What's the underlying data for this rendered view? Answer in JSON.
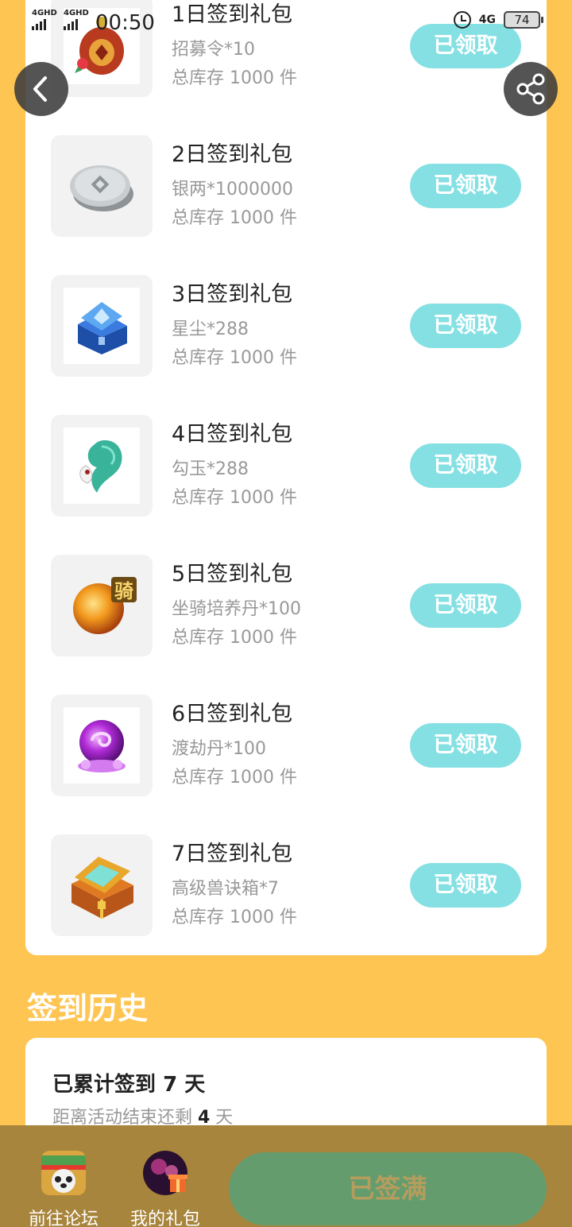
{
  "status_bar": {
    "sim1": "4GHD",
    "sim2": "4GHD",
    "time": "00:50",
    "network": "4G",
    "battery": "74"
  },
  "colors": {
    "page_bg": "#FFC552",
    "claim_button": "#85E0E3",
    "primary_button": "#659C6E",
    "bottom_bar": "#A8853C"
  },
  "nav": {
    "back_icon": "chevron-left-icon",
    "share_icon": "share-icon"
  },
  "gifts": [
    {
      "title": "1日签到礼包",
      "item": "招募令*10",
      "stock": "总库存 1000 件",
      "button": "已领取",
      "icon": "token-bag-icon"
    },
    {
      "title": "2日签到礼包",
      "item": "银两*1000000",
      "stock": "总库存 1000 件",
      "button": "已领取",
      "icon": "silver-coin-icon"
    },
    {
      "title": "3日签到礼包",
      "item": "星尘*288",
      "stock": "总库存 1000 件",
      "button": "已领取",
      "icon": "blue-chest-icon"
    },
    {
      "title": "4日签到礼包",
      "item": "勾玉*288",
      "stock": "总库存 1000 件",
      "button": "已领取",
      "icon": "magatama-icon"
    },
    {
      "title": "5日签到礼包",
      "item": "坐骑培养丹*100",
      "stock": "总库存 1000 件",
      "button": "已领取",
      "icon": "mount-pill-icon",
      "badge": "骑"
    },
    {
      "title": "6日签到礼包",
      "item": "渡劫丹*100",
      "stock": "总库存 1000 件",
      "button": "已领取",
      "icon": "purple-orb-icon"
    },
    {
      "title": "7日签到礼包",
      "item": "高级兽诀箱*7",
      "stock": "总库存 1000 件",
      "button": "已领取",
      "icon": "gold-chest-icon"
    }
  ],
  "history": {
    "title": "签到历史",
    "total_prefix": "已累计签到 ",
    "total_days": "7",
    "total_suffix": " 天",
    "remain_prefix": "距离活动结束还剩 ",
    "remain_days": "4",
    "remain_suffix": " 天"
  },
  "bottom": {
    "forum_label": "前往论坛",
    "mygift_label": "我的礼包",
    "main_button": "已签满"
  }
}
